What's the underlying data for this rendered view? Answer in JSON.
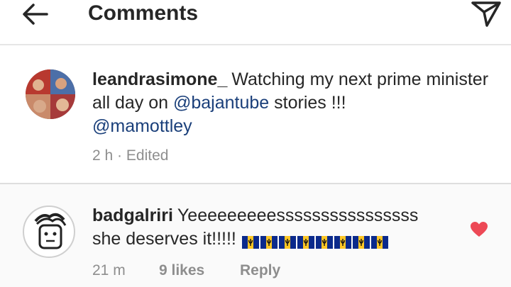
{
  "header": {
    "title": "Comments",
    "back_icon": "arrow-left-icon",
    "send_icon": "paper-plane-icon"
  },
  "caption": {
    "username": "leandrasimone_",
    "text_before": "Watching my next prime minister all day on",
    "mention_1": "@bajantube",
    "text_after": "stories !!!",
    "mention_2": "@mamottley",
    "time": "2 h",
    "separator": "·",
    "edited": "Edited"
  },
  "comment": {
    "username": "badgalriri",
    "text_line1": "Yeeeeeeeeessssssssssssssss",
    "text_line2": "she deserves it!!!!!",
    "flag_count": 8,
    "time": "21 m",
    "likes": "9 likes",
    "reply": "Reply",
    "liked": true
  },
  "colors": {
    "mention": "#1a3f7a",
    "heart": "#ed4956",
    "meta": "#8e8e8e",
    "flag_blue": "#0b2a8c",
    "flag_gold": "#ffc726"
  }
}
